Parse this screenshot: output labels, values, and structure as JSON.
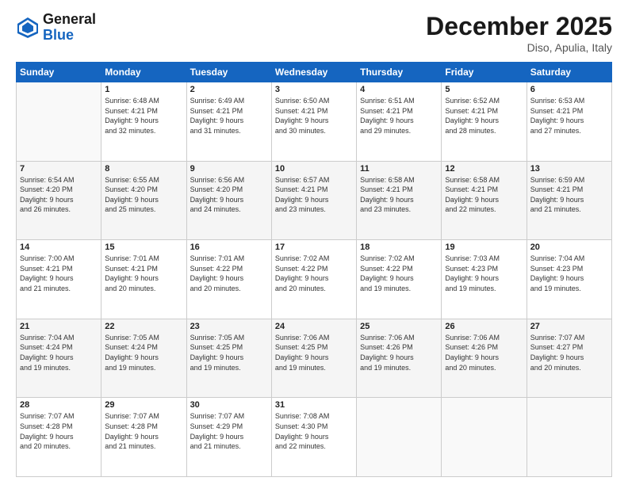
{
  "header": {
    "logo_line1": "General",
    "logo_line2": "Blue",
    "month": "December 2025",
    "location": "Diso, Apulia, Italy"
  },
  "days_of_week": [
    "Sunday",
    "Monday",
    "Tuesday",
    "Wednesday",
    "Thursday",
    "Friday",
    "Saturday"
  ],
  "weeks": [
    [
      {
        "day": "",
        "info": ""
      },
      {
        "day": "1",
        "info": "Sunrise: 6:48 AM\nSunset: 4:21 PM\nDaylight: 9 hours\nand 32 minutes."
      },
      {
        "day": "2",
        "info": "Sunrise: 6:49 AM\nSunset: 4:21 PM\nDaylight: 9 hours\nand 31 minutes."
      },
      {
        "day": "3",
        "info": "Sunrise: 6:50 AM\nSunset: 4:21 PM\nDaylight: 9 hours\nand 30 minutes."
      },
      {
        "day": "4",
        "info": "Sunrise: 6:51 AM\nSunset: 4:21 PM\nDaylight: 9 hours\nand 29 minutes."
      },
      {
        "day": "5",
        "info": "Sunrise: 6:52 AM\nSunset: 4:21 PM\nDaylight: 9 hours\nand 28 minutes."
      },
      {
        "day": "6",
        "info": "Sunrise: 6:53 AM\nSunset: 4:21 PM\nDaylight: 9 hours\nand 27 minutes."
      }
    ],
    [
      {
        "day": "7",
        "info": "Sunrise: 6:54 AM\nSunset: 4:20 PM\nDaylight: 9 hours\nand 26 minutes."
      },
      {
        "day": "8",
        "info": "Sunrise: 6:55 AM\nSunset: 4:20 PM\nDaylight: 9 hours\nand 25 minutes."
      },
      {
        "day": "9",
        "info": "Sunrise: 6:56 AM\nSunset: 4:20 PM\nDaylight: 9 hours\nand 24 minutes."
      },
      {
        "day": "10",
        "info": "Sunrise: 6:57 AM\nSunset: 4:21 PM\nDaylight: 9 hours\nand 23 minutes."
      },
      {
        "day": "11",
        "info": "Sunrise: 6:58 AM\nSunset: 4:21 PM\nDaylight: 9 hours\nand 23 minutes."
      },
      {
        "day": "12",
        "info": "Sunrise: 6:58 AM\nSunset: 4:21 PM\nDaylight: 9 hours\nand 22 minutes."
      },
      {
        "day": "13",
        "info": "Sunrise: 6:59 AM\nSunset: 4:21 PM\nDaylight: 9 hours\nand 21 minutes."
      }
    ],
    [
      {
        "day": "14",
        "info": "Sunrise: 7:00 AM\nSunset: 4:21 PM\nDaylight: 9 hours\nand 21 minutes."
      },
      {
        "day": "15",
        "info": "Sunrise: 7:01 AM\nSunset: 4:21 PM\nDaylight: 9 hours\nand 20 minutes."
      },
      {
        "day": "16",
        "info": "Sunrise: 7:01 AM\nSunset: 4:22 PM\nDaylight: 9 hours\nand 20 minutes."
      },
      {
        "day": "17",
        "info": "Sunrise: 7:02 AM\nSunset: 4:22 PM\nDaylight: 9 hours\nand 20 minutes."
      },
      {
        "day": "18",
        "info": "Sunrise: 7:02 AM\nSunset: 4:22 PM\nDaylight: 9 hours\nand 19 minutes."
      },
      {
        "day": "19",
        "info": "Sunrise: 7:03 AM\nSunset: 4:23 PM\nDaylight: 9 hours\nand 19 minutes."
      },
      {
        "day": "20",
        "info": "Sunrise: 7:04 AM\nSunset: 4:23 PM\nDaylight: 9 hours\nand 19 minutes."
      }
    ],
    [
      {
        "day": "21",
        "info": "Sunrise: 7:04 AM\nSunset: 4:24 PM\nDaylight: 9 hours\nand 19 minutes."
      },
      {
        "day": "22",
        "info": "Sunrise: 7:05 AM\nSunset: 4:24 PM\nDaylight: 9 hours\nand 19 minutes."
      },
      {
        "day": "23",
        "info": "Sunrise: 7:05 AM\nSunset: 4:25 PM\nDaylight: 9 hours\nand 19 minutes."
      },
      {
        "day": "24",
        "info": "Sunrise: 7:06 AM\nSunset: 4:25 PM\nDaylight: 9 hours\nand 19 minutes."
      },
      {
        "day": "25",
        "info": "Sunrise: 7:06 AM\nSunset: 4:26 PM\nDaylight: 9 hours\nand 19 minutes."
      },
      {
        "day": "26",
        "info": "Sunrise: 7:06 AM\nSunset: 4:26 PM\nDaylight: 9 hours\nand 20 minutes."
      },
      {
        "day": "27",
        "info": "Sunrise: 7:07 AM\nSunset: 4:27 PM\nDaylight: 9 hours\nand 20 minutes."
      }
    ],
    [
      {
        "day": "28",
        "info": "Sunrise: 7:07 AM\nSunset: 4:28 PM\nDaylight: 9 hours\nand 20 minutes."
      },
      {
        "day": "29",
        "info": "Sunrise: 7:07 AM\nSunset: 4:28 PM\nDaylight: 9 hours\nand 21 minutes."
      },
      {
        "day": "30",
        "info": "Sunrise: 7:07 AM\nSunset: 4:29 PM\nDaylight: 9 hours\nand 21 minutes."
      },
      {
        "day": "31",
        "info": "Sunrise: 7:08 AM\nSunset: 4:30 PM\nDaylight: 9 hours\nand 22 minutes."
      },
      {
        "day": "",
        "info": ""
      },
      {
        "day": "",
        "info": ""
      },
      {
        "day": "",
        "info": ""
      }
    ]
  ]
}
